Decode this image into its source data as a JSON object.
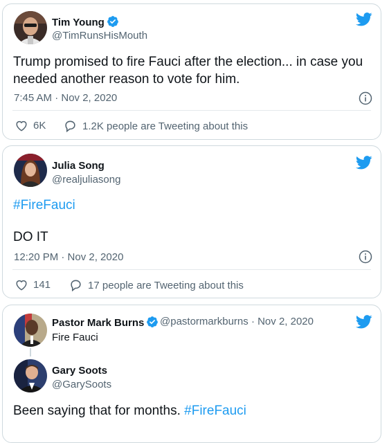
{
  "tweets": [
    {
      "author_name": "Tim Young",
      "author_handle": "@TimRunsHisMouth",
      "text": "Trump promised to fire Fauci after the election... in case you",
      "text_line2": "needed another reason to vote for him.",
      "timestamp": "7:45 AM · Nov 2, 2020",
      "likes": "6K",
      "retweet_text": "1.2K people are Tweeting about this"
    },
    {
      "author_name": "Julia Song",
      "author_handle": "@realjuliasong",
      "hashtag": "#FireFauci",
      "text": "DO IT",
      "timestamp": "12:20 PM · Nov 2, 2020",
      "likes": "141",
      "retweet_text": "17 people are Tweeting about this"
    },
    {
      "author_name": "Pastor Mark Burns",
      "author_handle": "@pastormarkburns · Nov 2, 2020",
      "text": "Fire Fauci",
      "reply": {
        "author_name": "Gary Soots",
        "author_handle": "@GarySoots",
        "text": "Been saying that for months.",
        "hashtag": "#FireFauci"
      }
    }
  ],
  "colors": {
    "accent": "#1d9bf0",
    "secondary_text": "#536471",
    "border": "#cfd9de"
  },
  "icons": [
    "twitter-bird-icon",
    "verified-badge-icon",
    "info-icon",
    "heart-icon",
    "reply-bubble-icon"
  ]
}
